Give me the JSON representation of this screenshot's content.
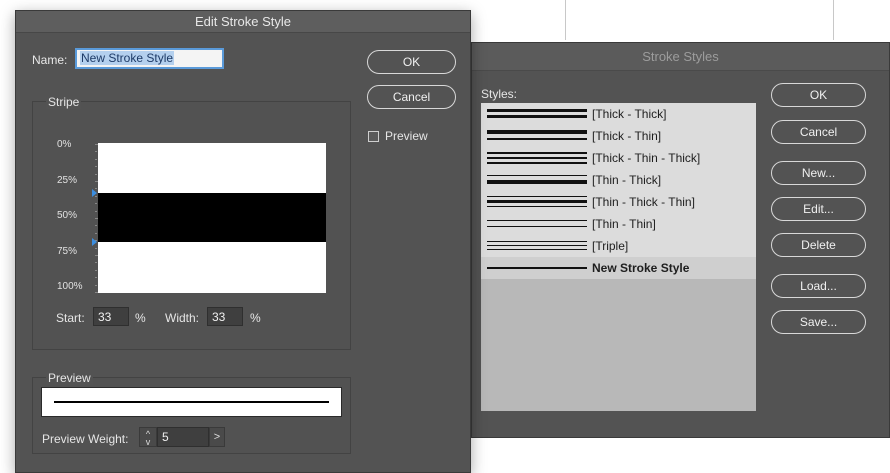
{
  "edit_dialog": {
    "title": "Edit Stroke Style",
    "name_label": "Name:",
    "name_value": "New Stroke Style",
    "ok_label": "OK",
    "cancel_label": "Cancel",
    "preview_check_label": "Preview",
    "preview_checked": false,
    "stripe": {
      "group_title": "Stripe",
      "ticks": [
        "0%",
        "25%",
        "50%",
        "75%",
        "100%"
      ],
      "start_label": "Start:",
      "start_value": "33",
      "width_label": "Width:",
      "width_value": "33",
      "unit": "%"
    },
    "preview": {
      "group_title": "Preview",
      "weight_label": "Preview Weight:",
      "weight_value": "5",
      "stepper_up": "^",
      "stepper_down": "v",
      "arrow": ">"
    }
  },
  "styles_dialog": {
    "title": "Stroke Styles",
    "styles_label": "Styles:",
    "items": [
      {
        "label": "[Thick - Thick]",
        "pattern": "thick-thick"
      },
      {
        "label": "[Thick - Thin]",
        "pattern": "thick-thin"
      },
      {
        "label": "[Thick - Thin - Thick]",
        "pattern": "thick-thin-thick"
      },
      {
        "label": "[Thin - Thick]",
        "pattern": "thin-thick"
      },
      {
        "label": "[Thin - Thick - Thin]",
        "pattern": "thin-thick-thin"
      },
      {
        "label": "[Thin - Thin]",
        "pattern": "thin-thin"
      },
      {
        "label": "[Triple]",
        "pattern": "triple"
      },
      {
        "label": "New Stroke Style",
        "pattern": "single",
        "selected": true
      }
    ],
    "buttons": {
      "ok": "OK",
      "cancel": "Cancel",
      "new": "New...",
      "edit": "Edit...",
      "delete": "Delete",
      "load": "Load...",
      "save": "Save..."
    }
  }
}
